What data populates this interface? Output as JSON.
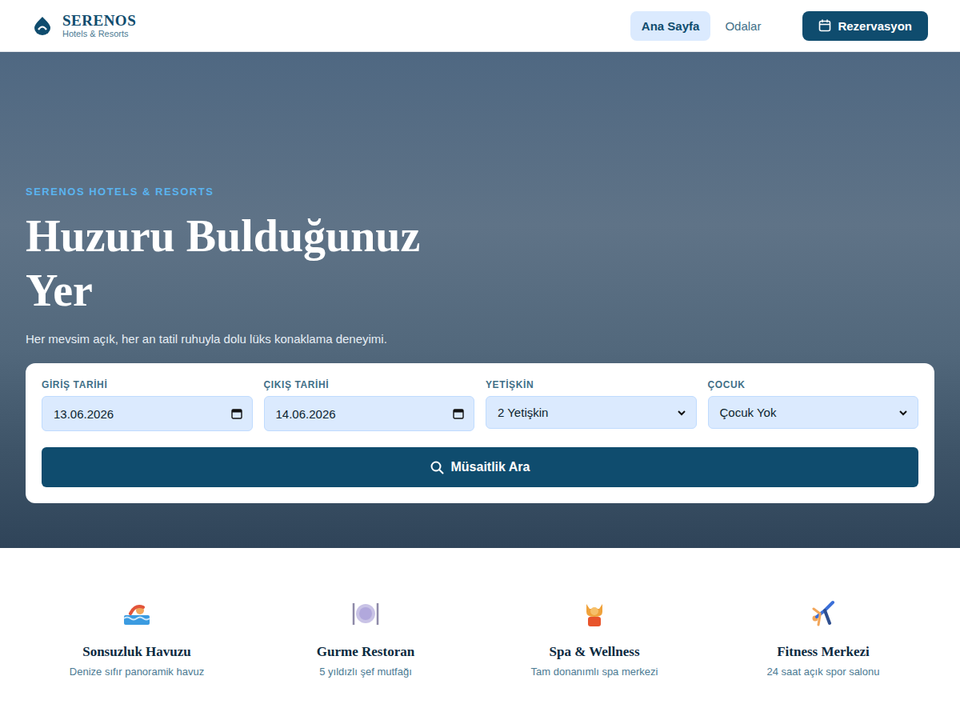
{
  "brand": {
    "name": "SERENOS",
    "tagline": "Hotels & Resorts"
  },
  "nav": [
    {
      "label": "Ana Sayfa",
      "selected": true
    },
    {
      "label": "Odalar",
      "selected": false
    }
  ],
  "cta": {
    "label": "Rezervasyon"
  },
  "hero": {
    "eyebrow": "SERENOS HOTELS & RESORTS",
    "title": "Huzuru Bulduğunuz Yer",
    "subtitle": "Her mevsim açık, her an tatil ruhuyla dolu lüks konaklama deneyimi."
  },
  "search": {
    "fields": [
      {
        "label": "GİRİŞ TARİHİ",
        "value": "13.06.2026",
        "kind": "date"
      },
      {
        "label": "ÇIKIŞ TARİHİ",
        "value": "14.06.2026",
        "kind": "date"
      },
      {
        "label": "YETİŞKİN",
        "value": "2 Yetişkin",
        "kind": "select"
      },
      {
        "label": "ÇOCUK",
        "value": "Çocuk Yok",
        "kind": "select"
      }
    ],
    "button": "Müsaitlik Ara"
  },
  "features": [
    {
      "title": "Sonsuzluk Havuzu",
      "description": "Denize sıfır panoramik havuz"
    },
    {
      "title": "Gurme Restoran",
      "description": "5 yıldızlı şef mutfağı"
    },
    {
      "title": "Spa & Wellness",
      "description": "Tam donanımlı spa merkezi"
    },
    {
      "title": "Fitness Merkezi",
      "description": "24 saat açık spor salonu"
    }
  ]
}
